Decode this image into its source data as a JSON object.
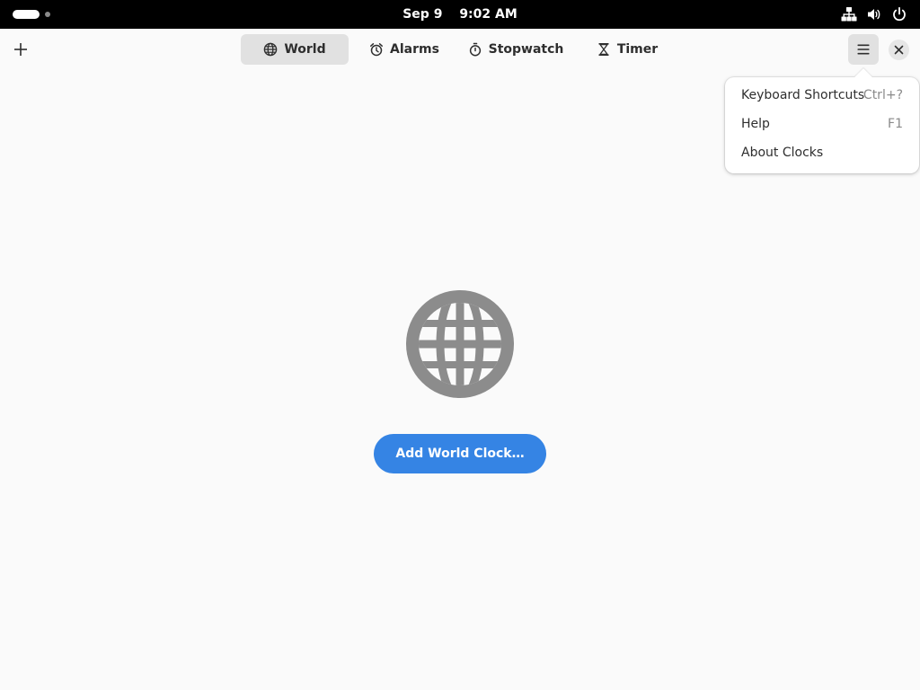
{
  "topbar": {
    "date": "Sep 9",
    "time": "9:02 AM",
    "icons": [
      "network-wired-icon",
      "volume-icon",
      "power-icon"
    ]
  },
  "header": {
    "tabs": [
      {
        "label": "World",
        "icon": "globe-icon",
        "active": true
      },
      {
        "label": "Alarms",
        "icon": "alarm-icon",
        "active": false
      },
      {
        "label": "Stopwatch",
        "icon": "stopwatch-icon",
        "active": false
      },
      {
        "label": "Timer",
        "icon": "hourglass-icon",
        "active": false
      }
    ]
  },
  "menu": {
    "items": [
      {
        "label": "Keyboard Shortcuts",
        "accel": "Ctrl+?"
      },
      {
        "label": "Help",
        "accel": "F1"
      },
      {
        "label": "About Clocks",
        "accel": ""
      }
    ]
  },
  "empty_state": {
    "icon": "globe-icon",
    "button_label": "Add World Clock…"
  },
  "colors": {
    "accent": "#3584e4",
    "background": "#fafafa",
    "topbar": "#000000"
  }
}
